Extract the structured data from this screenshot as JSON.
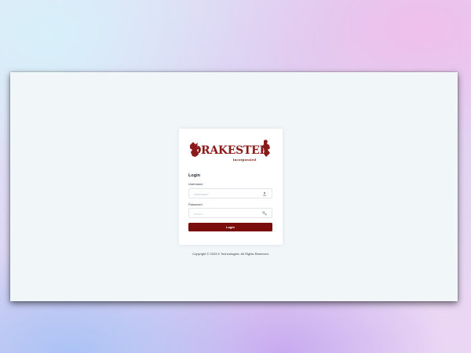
{
  "logo": {
    "brand": "DRAKESTER",
    "tagline": "Incorporated"
  },
  "login": {
    "title": "Login",
    "username_label": "Username",
    "username_placeholder": "Username",
    "password_label": "Password",
    "password_placeholder": "••••••••",
    "button_label": "Login"
  },
  "footer": {
    "copyright": "Copyright © 2023 K Technologies. All Rights Reserved."
  },
  "icons": {
    "username": "user-icon",
    "password": "key-icon"
  },
  "colors": {
    "brand": "#8b1a1a",
    "button": "#7a0c0c"
  }
}
